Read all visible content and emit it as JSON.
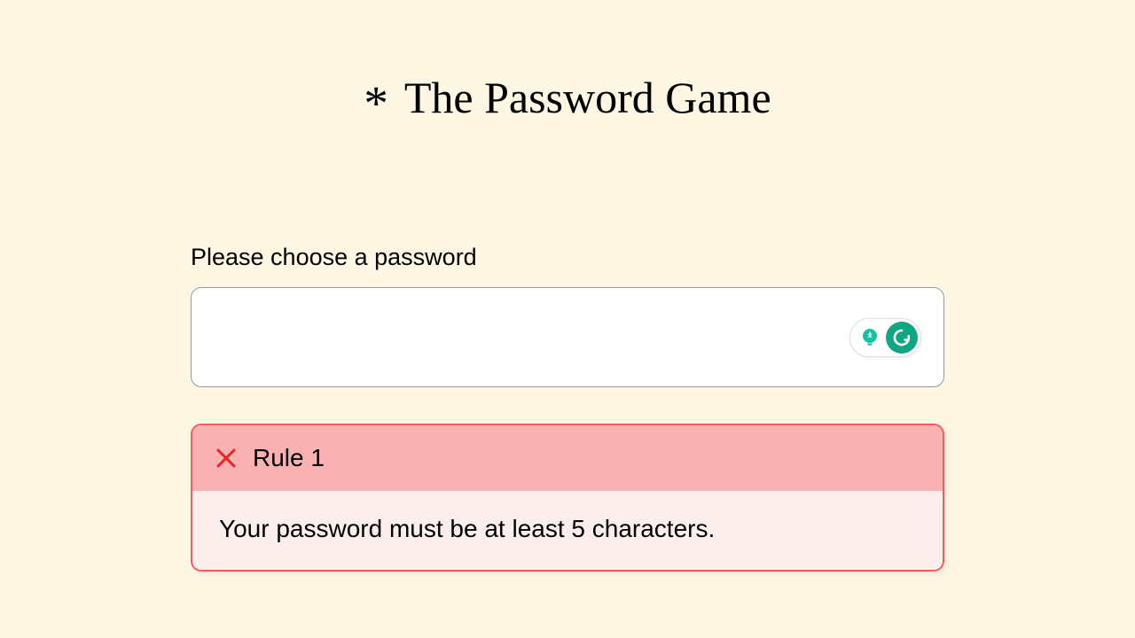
{
  "header": {
    "asterisk": "*",
    "title": "The Password Game"
  },
  "prompt": "Please choose a password",
  "password": {
    "value": "",
    "placeholder": ""
  },
  "extension": {
    "name": "grammarly"
  },
  "rule": {
    "status": "failed",
    "label": "Rule 1",
    "message": "Your password must be at least 5 characters."
  },
  "colors": {
    "background": "#fdf6e3",
    "error_border": "#f55c5c",
    "error_header_bg": "#f9b1b1",
    "error_body_bg": "#fdeeee",
    "x_icon": "#e72626",
    "grammarly_green": "#11a683"
  }
}
